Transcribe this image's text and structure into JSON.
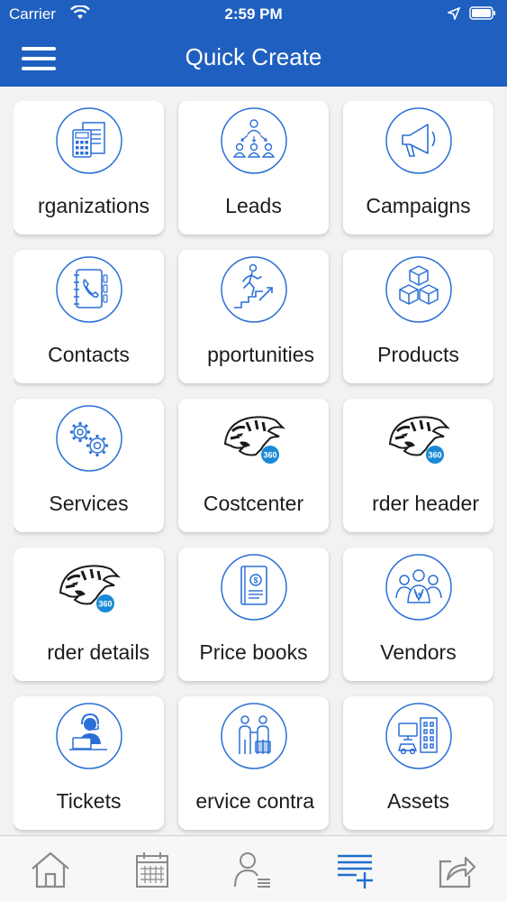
{
  "status": {
    "carrier": "Carrier",
    "time": "2:59 PM"
  },
  "nav": {
    "title": "Quick Create"
  },
  "tiles": [
    {
      "label": "rganizations",
      "icon": "calculator-document-icon"
    },
    {
      "label": "Leads",
      "icon": "people-hierarchy-icon"
    },
    {
      "label": "Campaigns",
      "icon": "megaphone-icon"
    },
    {
      "label": "Contacts",
      "icon": "phone-book-icon"
    },
    {
      "label": "pportunities",
      "icon": "running-stairs-icon"
    },
    {
      "label": "Products",
      "icon": "boxes-icon"
    },
    {
      "label": "Services",
      "icon": "gears-icon"
    },
    {
      "label": "Costcenter",
      "icon": "tiger-360-icon"
    },
    {
      "label": "rder header",
      "icon": "tiger-360-icon"
    },
    {
      "label": "rder details",
      "icon": "tiger-360-icon"
    },
    {
      "label": "Price books",
      "icon": "price-book-icon"
    },
    {
      "label": "Vendors",
      "icon": "vendors-icon"
    },
    {
      "label": "Tickets",
      "icon": "support-agent-icon"
    },
    {
      "label": "ervice contra",
      "icon": "service-contract-icon"
    },
    {
      "label": "Assets",
      "icon": "assets-icon"
    }
  ],
  "tiger_badge": "360",
  "tabs": [
    {
      "icon": "home-icon"
    },
    {
      "icon": "calendar-icon"
    },
    {
      "icon": "contacts-list-icon"
    },
    {
      "icon": "quick-create-icon"
    },
    {
      "icon": "share-icon"
    }
  ],
  "colors": {
    "brand": "#1f5fbf",
    "icon_blue": "#2a6fd6",
    "tab_active": "#1f6fd0",
    "tab_inactive": "#8a8a8a"
  }
}
